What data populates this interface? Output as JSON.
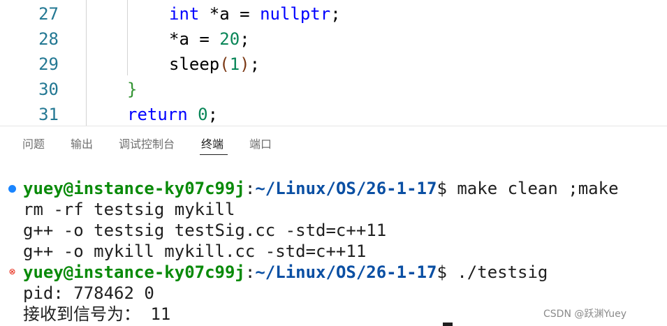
{
  "editor": {
    "lines": [
      {
        "num": "27",
        "indent": "        ",
        "parts": [
          {
            "t": "int",
            "c": "kw"
          },
          {
            "t": " *a = ",
            "c": "fn"
          },
          {
            "t": "nullptr",
            "c": "kw"
          },
          {
            "t": ";",
            "c": "fn"
          }
        ]
      },
      {
        "num": "28",
        "indent": "        ",
        "parts": [
          {
            "t": "*a = ",
            "c": "fn"
          },
          {
            "t": "20",
            "c": "num"
          },
          {
            "t": ";",
            "c": "fn"
          }
        ]
      },
      {
        "num": "29",
        "indent": "        ",
        "parts": [
          {
            "t": "sleep",
            "c": "fn"
          },
          {
            "t": "(",
            "c": "br2"
          },
          {
            "t": "1",
            "c": "num"
          },
          {
            "t": ")",
            "c": "br2"
          },
          {
            "t": ";",
            "c": "fn"
          }
        ]
      },
      {
        "num": "30",
        "indent": "    ",
        "parts": [
          {
            "t": "}",
            "c": "br"
          }
        ]
      },
      {
        "num": "31",
        "indent": "    ",
        "parts": [
          {
            "t": "return",
            "c": "kw"
          },
          {
            "t": " ",
            "c": "fn"
          },
          {
            "t": "0",
            "c": "num"
          },
          {
            "t": ";",
            "c": "fn"
          }
        ]
      }
    ]
  },
  "panel": {
    "tabs": [
      "问题",
      "输出",
      "调试控制台",
      "终端",
      "端口"
    ],
    "active_tab": "终端"
  },
  "terminal": {
    "prompt1": {
      "user": "yuey@instance-ky07c99j",
      "colon": ":",
      "path": "~/Linux/OS/26-1-17",
      "dollar": "$",
      "command": " make clean ;make"
    },
    "output1": [
      "rm -rf testsig mykill",
      "g++ -o testsig testSig.cc -std=c++11",
      "g++ -o mykill mykill.cc -std=c++11"
    ],
    "prompt2": {
      "user": "yuey@instance-ky07c99j",
      "colon": ":",
      "path": "~/Linux/OS/26-1-17",
      "dollar": "$",
      "command": " ./testsig"
    },
    "output2": [
      "pid: 778462 0",
      "接收到信号为： 11"
    ]
  },
  "watermark": "CSDN @跃渊Yuey",
  "colors": {
    "keyword": "#0000ff",
    "number": "#098658",
    "line_number": "#237893",
    "prompt_user": "#098a09",
    "prompt_path": "#0a4fa3",
    "error_icon": "#e51400",
    "success_dot": "#1a85ff"
  }
}
